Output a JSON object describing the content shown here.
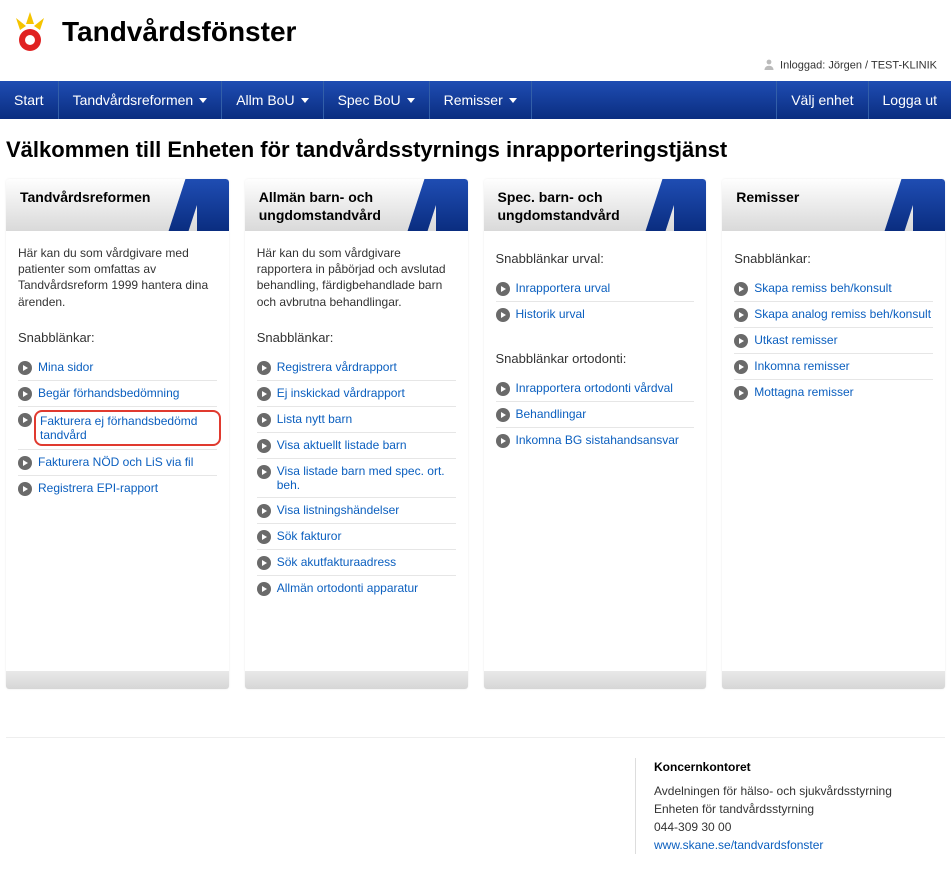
{
  "site": {
    "title": "Tandvårdsfönster"
  },
  "login": {
    "label": "Inloggad:",
    "user": "Jörgen",
    "sep": "/",
    "unit": "TEST-KLINIK"
  },
  "nav": {
    "items": [
      {
        "label": "Start",
        "dropdown": false
      },
      {
        "label": "Tandvårdsreformen",
        "dropdown": true
      },
      {
        "label": "Allm BoU",
        "dropdown": true
      },
      {
        "label": "Spec BoU",
        "dropdown": true
      },
      {
        "label": "Remisser",
        "dropdown": true
      }
    ],
    "right": [
      {
        "label": "Välj enhet"
      },
      {
        "label": "Logga ut"
      }
    ]
  },
  "page_title": "Välkommen till Enheten för tandvårdsstyrnings inrapporteringstjänst",
  "cards": [
    {
      "title": "Tandvårdsreformen",
      "desc": "Här kan du som vårdgivare med patienter som omfattas av Tandvårdsreform 1999 hantera dina ärenden.",
      "sections": [
        {
          "title": "Snabblänkar:",
          "links": [
            {
              "label": "Mina sidor"
            },
            {
              "label": "Begär förhandsbedömning"
            },
            {
              "label": "Fakturera ej förhandsbedömd tandvård",
              "highlight": true
            },
            {
              "label": "Fakturera NÖD och LiS via fil"
            },
            {
              "label": "Registrera EPI-rapport"
            }
          ]
        }
      ]
    },
    {
      "title": "Allmän barn- och ungdomstandvård",
      "desc": "Här kan du som vårdgivare rapportera in påbörjad och avslutad behandling, färdigbehandlade barn och avbrutna behandlingar.",
      "sections": [
        {
          "title": "Snabblänkar:",
          "links": [
            {
              "label": "Registrera vårdrapport"
            },
            {
              "label": "Ej inskickad vårdrapport"
            },
            {
              "label": "Lista nytt barn"
            },
            {
              "label": "Visa aktuellt listade barn"
            },
            {
              "label": "Visa listade barn med spec. ort. beh."
            },
            {
              "label": "Visa listningshändelser"
            },
            {
              "label": "Sök fakturor"
            },
            {
              "label": "Sök akutfakturaadress"
            },
            {
              "label": "Allmän ortodonti apparatur"
            }
          ]
        }
      ]
    },
    {
      "title": "Spec. barn- och ungdomstandvård",
      "desc": "",
      "sections": [
        {
          "title": "Snabblänkar urval:",
          "links": [
            {
              "label": "Inrapportera urval"
            },
            {
              "label": "Historik urval"
            }
          ]
        },
        {
          "title": "Snabblänkar ortodonti:",
          "links": [
            {
              "label": "Inrapportera ortodonti vårdval"
            },
            {
              "label": "Behandlingar"
            },
            {
              "label": "Inkomna BG sistahandsansvar"
            }
          ]
        }
      ]
    },
    {
      "title": "Remisser",
      "desc": "",
      "sections": [
        {
          "title": "Snabblänkar:",
          "links": [
            {
              "label": "Skapa remiss beh/konsult"
            },
            {
              "label": "Skapa analog remiss beh/konsult"
            },
            {
              "label": "Utkast remisser"
            },
            {
              "label": "Inkomna remisser"
            },
            {
              "label": "Mottagna remisser"
            }
          ]
        }
      ]
    }
  ],
  "footer": {
    "org": "Koncernkontoret",
    "line1": "Avdelningen för hälso- och sjukvårdsstyrning",
    "line2": "Enheten för tandvårdsstyrning",
    "phone": "044-309 30 00",
    "link": "www.skane.se/tandvardsfonster"
  }
}
